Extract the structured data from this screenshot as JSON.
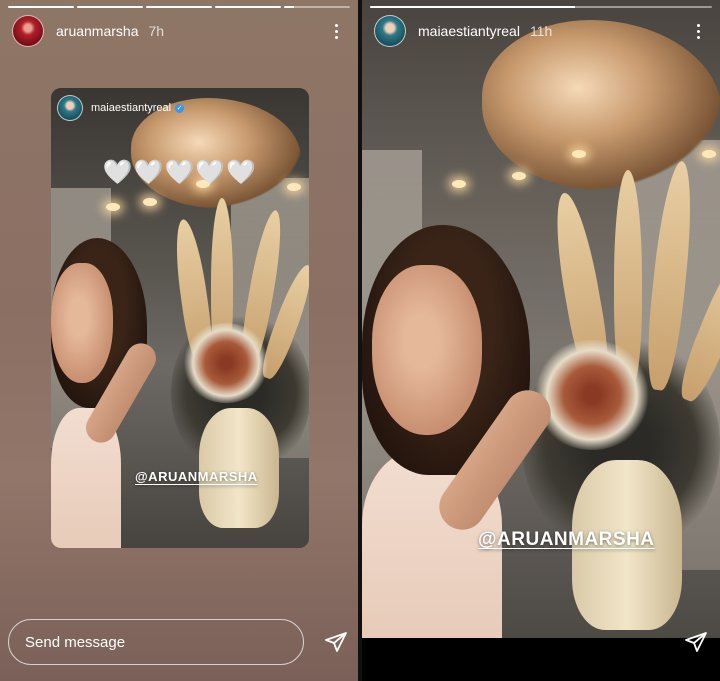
{
  "left_story": {
    "username": "aruanmarsha",
    "time": "7h",
    "progress": [
      1,
      1,
      1,
      1,
      0.15
    ],
    "embedded_post": {
      "username": "maiaestiantyreal",
      "verified": true,
      "hearts": "🤍🤍🤍🤍🤍",
      "mention": "@ARUANMARSHA"
    },
    "send_message_placeholder": "Send message"
  },
  "right_story": {
    "username": "maiaestiantyreal",
    "time": "11h",
    "progress": [
      0.6
    ],
    "mention": "@ARUANMARSHA"
  },
  "icons": {
    "more": "more-options-icon",
    "send": "send-icon",
    "verified": "verified-badge-icon"
  },
  "colors": {
    "verified": "#3897f0",
    "left_background": "#8b6f63"
  }
}
